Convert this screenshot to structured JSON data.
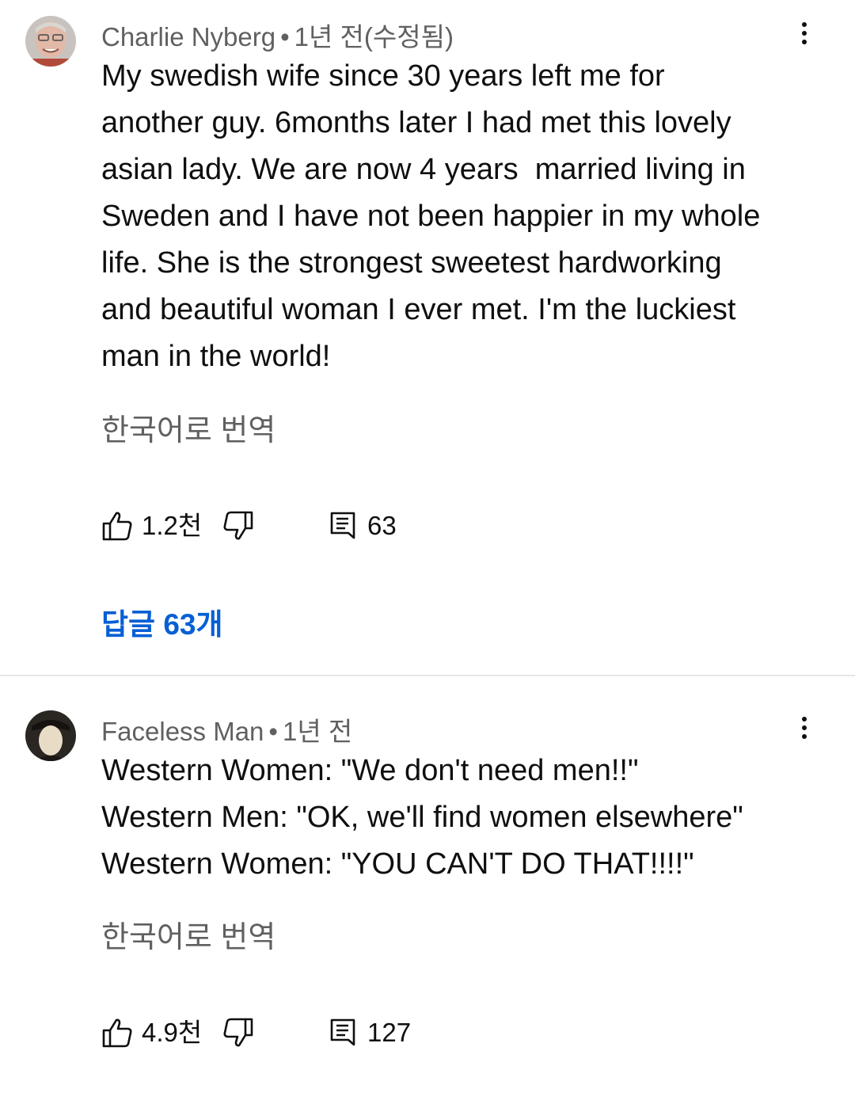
{
  "comments": [
    {
      "author": "Charlie Nyberg",
      "separator": "•",
      "time": "1년 전(수정됨)",
      "avatar_icon": "profile-photo-icon",
      "lines": [
        "My swedish wife since 30 years left me for",
        "another guy. 6months later I had met this lovely",
        "asian lady. We are now 4 years  married living in",
        "Sweden and I have not been happier in my whole",
        "life. She is the strongest sweetest hardworking",
        "and beautiful woman I ever met. I'm the luckiest",
        "man in the world!"
      ],
      "translate_label": "한국어로 번역",
      "likes": "1.2천",
      "reply_count": "63",
      "replies_link": "답글 63개"
    },
    {
      "author": "Faceless Man",
      "separator": "•",
      "time": "1년 전",
      "avatar_icon": "profile-photo-icon",
      "lines": [
        "Western Women: \"We don't need men!!\"",
        "Western Men: \"OK, we'll find women elsewhere\"",
        "Western Women: \"YOU CAN'T DO THAT!!!!\""
      ],
      "translate_label": "한국어로 번역",
      "likes": "4.9천",
      "reply_count": "127"
    }
  ],
  "icons": {
    "like": "thumbs-up-icon",
    "dislike": "thumbs-down-icon",
    "reply": "comment-icon",
    "more": "more-vert-icon"
  },
  "colors": {
    "link": "#065fd4",
    "secondary_text": "#606060",
    "primary_text": "#0f0f0f",
    "divider": "#e5e5e5"
  }
}
